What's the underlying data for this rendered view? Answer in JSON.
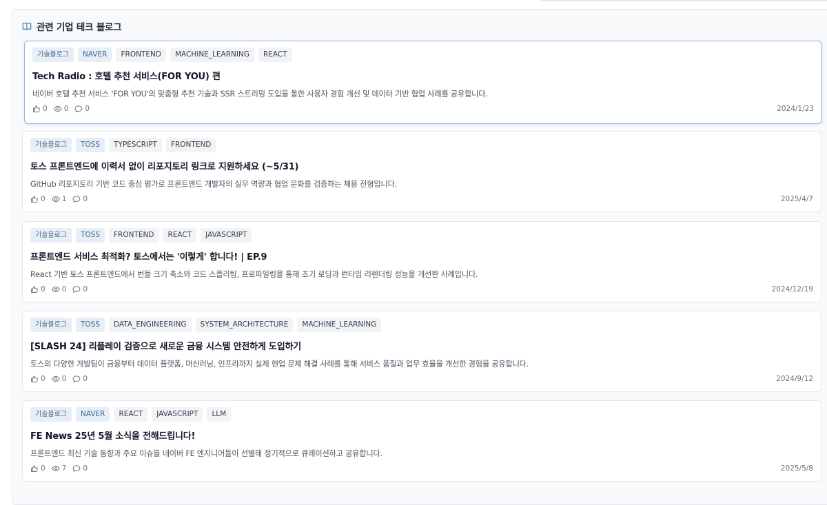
{
  "section": {
    "title": "관련 기업 테크 블로그",
    "icon": "book-open-icon"
  },
  "posts": [
    {
      "category": "기술블로그",
      "company": "NAVER",
      "tags": [
        "FRONTEND",
        "MACHINE_LEARNING",
        "REACT"
      ],
      "title": "Tech Radio : 호텔 추천 서비스(FOR YOU) 편",
      "description": "네이버 호텔 추천 서비스 'FOR YOU'의 맞춤형 추천 기술과 SSR 스트리밍 도입을 통한 사용자 경험 개선 및 데이터 기반 협업 사례를 공유합니다.",
      "likes": "0",
      "views": "0",
      "comments": "0",
      "date": "2024/1/23"
    },
    {
      "category": "기술블로그",
      "company": "TOSS",
      "tags": [
        "TYPESCRIPT",
        "FRONTEND"
      ],
      "title": "토스 프론트엔드에 이력서 없이 리포지토리 링크로 지원하세요 (~5/31)",
      "description": "GitHub 리포지토리 기반 코드 중심 평가로 프론트엔드 개발자의 실무 역량과 협업 문화를 검증하는 채용 전형입니다.",
      "likes": "0",
      "views": "1",
      "comments": "0",
      "date": "2025/4/7"
    },
    {
      "category": "기술블로그",
      "company": "TOSS",
      "tags": [
        "FRONTEND",
        "REACT",
        "JAVASCRIPT"
      ],
      "title": "프론트엔드 서비스 최적화? 토스에서는 '이렇게' 합니다! | EP.9",
      "description": "React 기반 토스 프론트엔드에서 번들 크기 축소와 코드 스플리팅, 프로파일링을 통해 초기 로딩과 런타임 리렌더링 성능을 개선한 사례입니다.",
      "likes": "0",
      "views": "0",
      "comments": "0",
      "date": "2024/12/19"
    },
    {
      "category": "기술블로그",
      "company": "TOSS",
      "tags": [
        "DATA_ENGINEERING",
        "SYSTEM_ARCHITECTURE",
        "MACHINE_LEARNING"
      ],
      "title": "[SLASH 24] 리플레이 검증으로 새로운 금융 시스템 안전하게 도입하기",
      "description": "토스의 다양한 개발팀이 금융부터 데이터 플랫폼, 머신러닝, 인프라까지 실제 현업 문제 해결 사례를 통해 서비스 품질과 업무 효율을 개선한 경험을 공유합니다.",
      "likes": "0",
      "views": "0",
      "comments": "0",
      "date": "2024/9/12"
    },
    {
      "category": "기술블로그",
      "company": "NAVER",
      "tags": [
        "REACT",
        "JAVASCRIPT",
        "LLM"
      ],
      "title": "FE News 25년 5월 소식을 전해드립니다!",
      "description": "프론트엔드 최신 기술 동향과 주요 이슈를 네이버 FE 엔지니어들이 선별해 정기적으로 큐레이션하고 공유합니다.",
      "likes": "0",
      "views": "7",
      "comments": "0",
      "date": "2025/5/8"
    }
  ],
  "icons": {
    "like": "thumbs-up-icon",
    "view": "eye-icon",
    "comment": "comment-icon"
  }
}
